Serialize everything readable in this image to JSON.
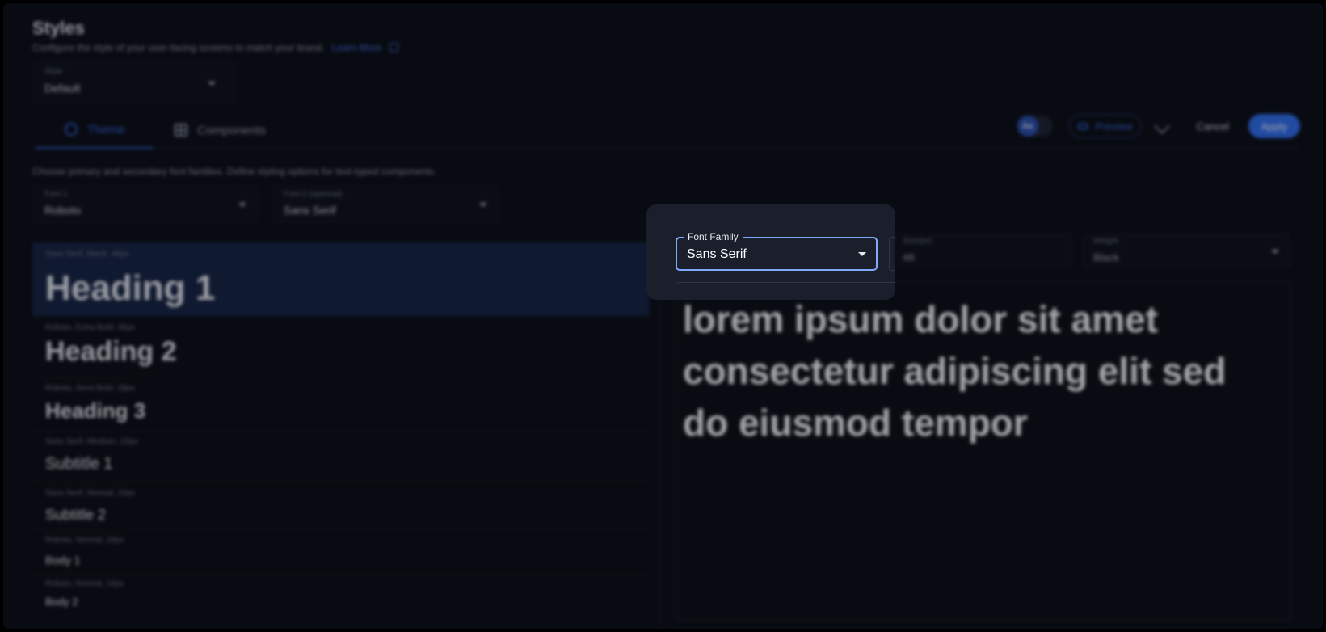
{
  "page": {
    "title": "Styles",
    "description": "Configure the style of your user-facing screens to match your brand.",
    "learn_more": "Learn More"
  },
  "style_select": {
    "label": "Style",
    "value": "Default"
  },
  "tabs": [
    {
      "label": "Theme",
      "icon": "palette-icon",
      "active": true
    },
    {
      "label": "Components",
      "icon": "grid-icon",
      "active": false
    }
  ],
  "toolbar": {
    "theme_toggle": "Aa",
    "preview_label": "Preview",
    "cancel_label": "Cancel",
    "apply_label": "Apply"
  },
  "section": {
    "description": "Choose primary and secondary font families. Define styling options for text-typed components."
  },
  "fonts": {
    "font1": {
      "label": "Font 1",
      "value": "Roboto"
    },
    "font2": {
      "label": "Font 2 (optional)",
      "value": "Sans Serif"
    }
  },
  "type_styles": [
    {
      "meta": "Sans Serif, Black, 48px",
      "sample": "Heading 1",
      "selected": true
    },
    {
      "meta": "Roboto, Extra Bold, 38px",
      "sample": "Heading 2"
    },
    {
      "meta": "Roboto, Semi Bold, 28px",
      "sample": "Heading 3"
    },
    {
      "meta": "Sans Serif, Medium, 22px",
      "sample": "Subtitle 1"
    },
    {
      "meta": "Sans Serif, Normal, 22px",
      "sample": "Subtitle 2"
    },
    {
      "meta": "Roboto, Normal, 18px",
      "sample": "Body 1"
    },
    {
      "meta": "Roboto, Normal, 14px",
      "sample": "Body 2"
    }
  ],
  "editor": {
    "font_family": {
      "label": "Font Family",
      "value": "Sans Serif"
    },
    "size": {
      "label": "Size(px)",
      "value": "48"
    },
    "weight": {
      "label": "Weight",
      "value": "Black"
    },
    "preview_text": "lorem ipsum dolor sit amet consectetur adipiscing elit sed do eiusmod tempor"
  },
  "colors": {
    "accent": "#2f6be8",
    "selected_row": "#142240",
    "focus_outline": "#7fa8ff",
    "background": "#0b0e15"
  }
}
